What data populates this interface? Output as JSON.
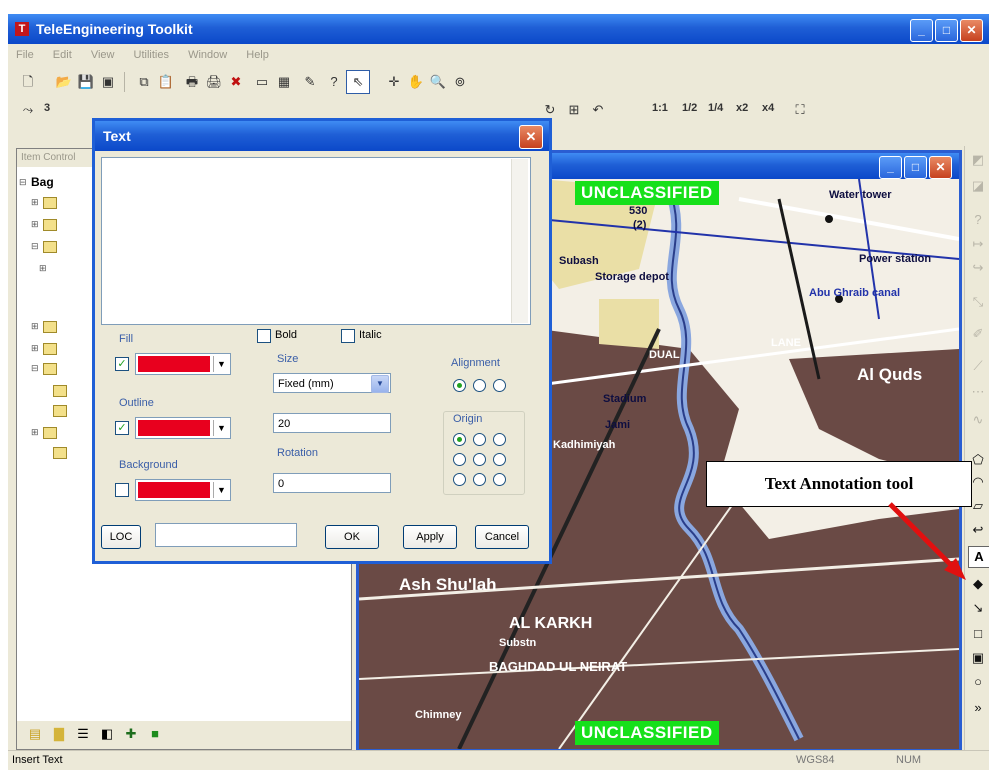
{
  "window": {
    "title": "TeleEngineering Toolkit",
    "minimize": "_",
    "maximize": "□",
    "close": "✕",
    "icon": "app-logo-icon"
  },
  "menu": [
    "File",
    "Edit",
    "View",
    "Utilities",
    "Window",
    "Help"
  ],
  "toolbar": {
    "scale_value": "3",
    "zoom_labels": [
      "1:1",
      "1/2",
      "1/4",
      "x2",
      "x4"
    ]
  },
  "left_panel": {
    "header": "Item Control",
    "tree_root": "Bag"
  },
  "map": {
    "banner_top": "UNCLASSIFIED",
    "banner_bottom": "UNCLASSIFIED",
    "labels": [
      "Water tower",
      "Power station",
      "Storage depot",
      "Subash",
      "Abu Ghraib canal",
      "Al Quds",
      "Stadium",
      "Jami",
      "Kadhimiyah",
      "Ash Shu'lah",
      "AL KARKH",
      "BAGHDAD UL NEIRAT",
      "Substn",
      "Chimney",
      "530",
      "(2)",
      "DUAL",
      "LANE"
    ]
  },
  "dialog": {
    "title": "Text",
    "close": "✕",
    "text_value": "",
    "fill_label": "Fill",
    "outline_label": "Outline",
    "background_label": "Background",
    "bold_label": "Bold",
    "italic_label": "Italic",
    "size_label": "Size",
    "size_mode": "Fixed (mm)",
    "size_value": "20",
    "rotation_label": "Rotation",
    "rotation_value": "0",
    "alignment_label": "Alignment",
    "origin_label": "Origin",
    "loc_button": "LOC",
    "loc_value": "",
    "ok_button": "OK",
    "apply_button": "Apply",
    "cancel_button": "Cancel",
    "fill_checked": true,
    "outline_checked": true,
    "background_checked": false,
    "fill_color": "#e8001e",
    "outline_color": "#e8001e",
    "background_color": "#e8001e"
  },
  "annotation": {
    "callout": "Text Annotation tool",
    "arrow_color": "#e01010"
  },
  "right_toolbar": {
    "selected": "A"
  },
  "status": {
    "left": "Insert Text",
    "datum": "WGS84",
    "num": "NUM"
  }
}
